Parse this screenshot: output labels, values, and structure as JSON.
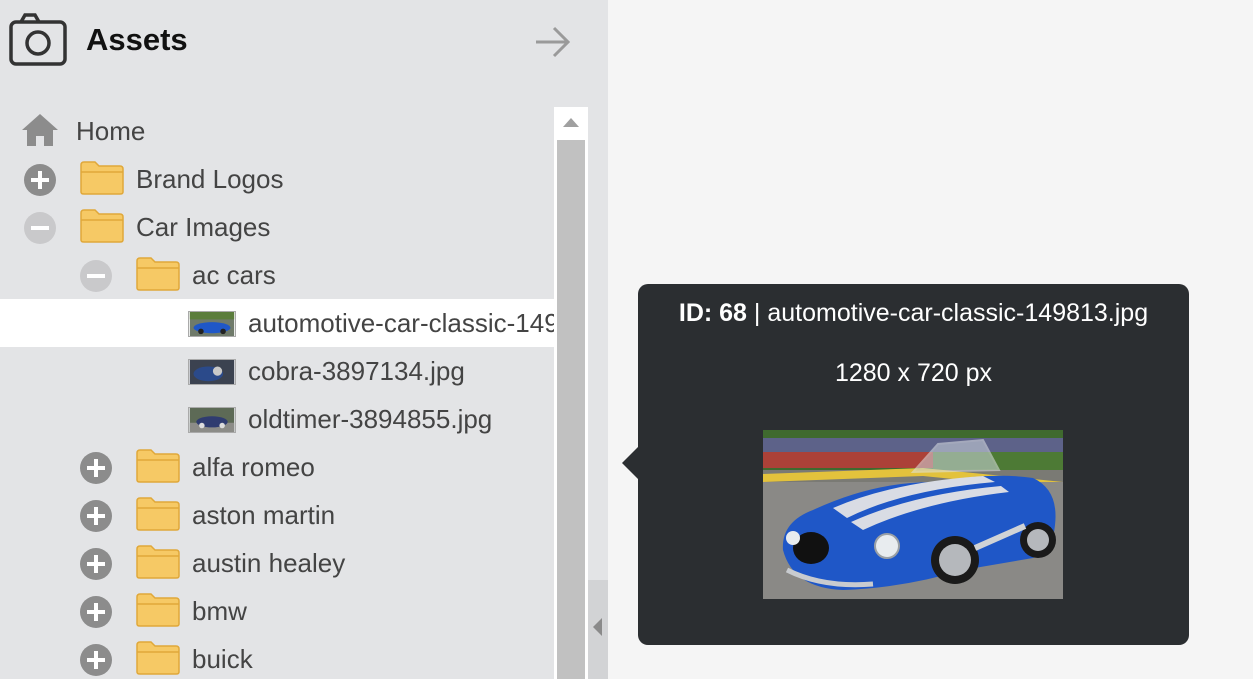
{
  "panel": {
    "title": "Assets",
    "icon": "camera-icon",
    "collapse_icon": "arrow-right-icon"
  },
  "tree": {
    "home": {
      "label": "Home",
      "icon": "home-icon"
    },
    "items": [
      {
        "label": "Brand Logos",
        "state": "collapsed",
        "type": "folder"
      },
      {
        "label": "Car Images",
        "state": "expanded",
        "type": "folder"
      },
      {
        "label": "ac cars",
        "state": "expanded",
        "type": "folder"
      },
      {
        "label": "automotive-car-classic-149813.jpg",
        "type": "image",
        "selected": true
      },
      {
        "label": "cobra-3897134.jpg",
        "type": "image"
      },
      {
        "label": "oldtimer-3894855.jpg",
        "type": "image"
      },
      {
        "label": "alfa romeo",
        "state": "collapsed",
        "type": "folder"
      },
      {
        "label": "aston martin",
        "state": "collapsed",
        "type": "folder"
      },
      {
        "label": "austin healey",
        "state": "collapsed",
        "type": "folder"
      },
      {
        "label": "bmw",
        "state": "collapsed",
        "type": "folder"
      },
      {
        "label": "buick",
        "state": "collapsed",
        "type": "folder"
      }
    ]
  },
  "tooltip": {
    "id_label": "ID: 68",
    "separator": "|",
    "filename": "automotive-car-classic-149813.jpg",
    "dimensions": "1280 x 720 px"
  },
  "colors": {
    "panel_bg": "#e3e4e6",
    "tooltip_bg": "#2b2e31",
    "folder": "#f6c965",
    "car_blue": "#1f57c7"
  }
}
